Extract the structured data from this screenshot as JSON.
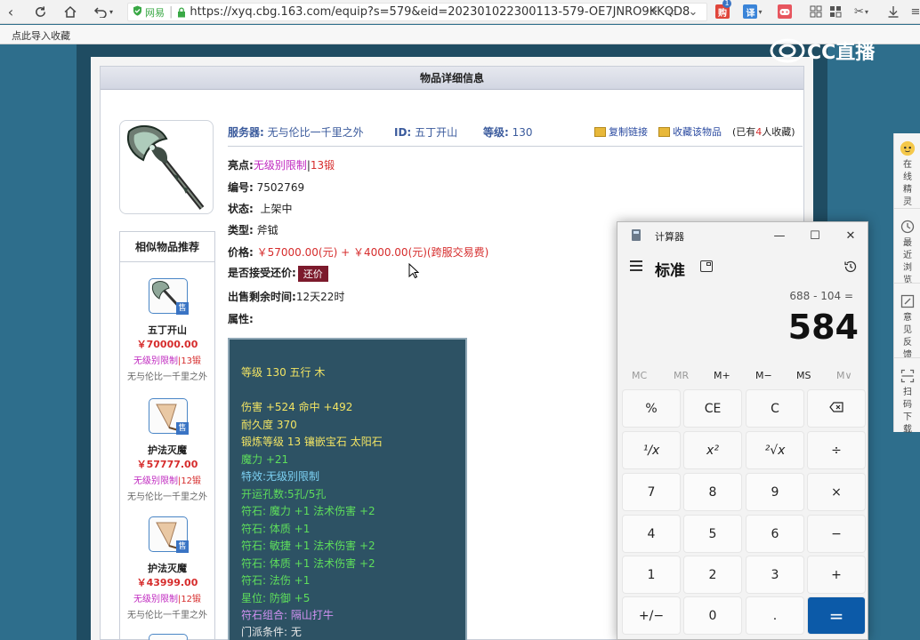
{
  "browser": {
    "secure_label": "网易",
    "url": "https://xyq.cbg.163.com/equip?s=579&eid=202301022300113-579-OE7JNRO9KKQD8",
    "bookmark_label": "点此导入收藏",
    "ext_badges": [
      "购",
      "译"
    ],
    "notification_count": "1"
  },
  "watermark": "CC直播",
  "detail": {
    "heading": "物品详细信息",
    "server_label": "服务器:",
    "server": "无与伦比一千里之外",
    "id_label": "ID:",
    "id_value": "五丁开山",
    "level_label": "等级:",
    "level_value": "130",
    "copy_link": "复制链接",
    "favorite": "收藏该物品",
    "fav_pre": "(已有",
    "fav_count": "4",
    "fav_post": "人收藏)",
    "highlight_label": "亮点:",
    "highlight_a": "无级别限制",
    "highlight_sep": "|",
    "highlight_b": "13锻",
    "number_label": "编号:",
    "number_value": "7502769",
    "status_label": "状态:",
    "status_value": "上架中",
    "type_label": "类型:",
    "type_value": "斧钺",
    "price_label": "价格:",
    "price_value": "￥57000.00(元) + ￥4000.00(元)(跨服交易费)",
    "counter_label": "是否接受还价:",
    "counter_button": "还价",
    "remaining_label": "出售剩余时间:",
    "remaining_value": "12天22时",
    "attr_label": "属性:"
  },
  "properties": [
    {
      "text": "等级 130 五行 木",
      "color": "#f2e463"
    },
    {
      "text": "伤害 +524 命中 +492",
      "color": "#f2e463"
    },
    {
      "text": "耐久度 370",
      "color": "#f2e463"
    },
    {
      "text": "锻炼等级 13 镶嵌宝石 太阳石",
      "color": "#f2e463"
    },
    {
      "text": "魔力 +21",
      "color": "#5ede5b"
    },
    {
      "text": "特效:无级别限制",
      "color": "#7cd0f2"
    },
    {
      "text": "开运孔数:5孔/5孔",
      "color": "#5ede5b"
    },
    {
      "text": "符石: 魔力 +1 法术伤害 +2",
      "color": "#5ede5b"
    },
    {
      "text": "符石: 体质 +1",
      "color": "#5ede5b"
    },
    {
      "text": "符石: 敏捷 +1 法术伤害 +2",
      "color": "#5ede5b"
    },
    {
      "text": "符石: 体质 +1 法术伤害 +2",
      "color": "#5ede5b"
    },
    {
      "text": "符石: 法伤 +1",
      "color": "#5ede5b"
    },
    {
      "text": "星位: 防御 +5",
      "color": "#5ede5b"
    },
    {
      "text": "符石组合: 隔山打牛",
      "color": "#d292f2"
    },
    {
      "text": "门派条件: 无",
      "color": "#e8e8e8"
    }
  ],
  "similar": {
    "title": "相似物品推荐",
    "sold_badge": "售",
    "items": [
      {
        "name": "五丁开山",
        "price": "￥70000.00",
        "tag_a": "无级别限制",
        "tag_b": "|13锻",
        "server": "无与伦比一千里之外"
      },
      {
        "name": "护法灭魔",
        "price": "￥57777.00",
        "tag_a": "无级别限制",
        "tag_b": "|12锻",
        "server": "无与伦比一千里之外"
      },
      {
        "name": "护法灭魔",
        "price": "￥43999.00",
        "tag_a": "无级别限制",
        "tag_b": "|12锻",
        "server": "无与伦比一千里之外"
      }
    ]
  },
  "sidebar": [
    {
      "label": "在线精灵",
      "icon": "avatar-icon"
    },
    {
      "label": "最近浏览",
      "icon": "clock-icon"
    },
    {
      "label": "意见反馈",
      "icon": "edit-icon"
    },
    {
      "label": "扫码下载",
      "icon": "scan-icon"
    }
  ],
  "calculator": {
    "title": "计算器",
    "mode": "标准",
    "expression": "688 - 104 =",
    "result": "584",
    "memory": [
      "MC",
      "MR",
      "M+",
      "M−",
      "MS",
      "M∨"
    ],
    "keys": [
      [
        "%",
        "CE",
        "C",
        "⌫"
      ],
      [
        "¹/x",
        "x²",
        "²√x",
        "÷"
      ],
      [
        "7",
        "8",
        "9",
        "×"
      ],
      [
        "4",
        "5",
        "6",
        "−"
      ],
      [
        "1",
        "2",
        "3",
        "+"
      ],
      [
        "+/−",
        "0",
        ".",
        "="
      ]
    ],
    "accent": "#0c5aa8"
  }
}
